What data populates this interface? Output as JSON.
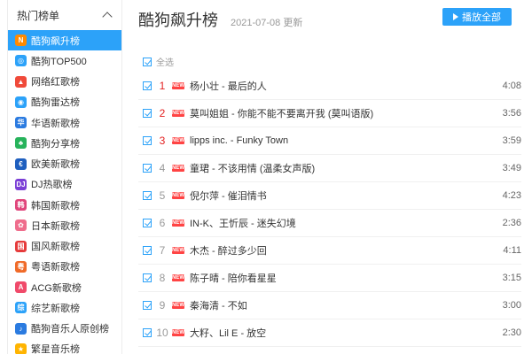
{
  "sidebar": {
    "header": "热门榜单",
    "items": [
      {
        "label": "酷狗飙升榜",
        "icon": "n-badge-icon",
        "color": "#ff8a00",
        "glyph": "N"
      },
      {
        "label": "酷狗TOP500",
        "icon": "disc-icon",
        "color": "#2ca2f9",
        "glyph": "◎"
      },
      {
        "label": "网络红歌榜",
        "icon": "flame-icon",
        "color": "#f04a3a",
        "glyph": "▲"
      },
      {
        "label": "酷狗雷达榜",
        "icon": "radar-icon",
        "color": "#2ca2f9",
        "glyph": "◉"
      },
      {
        "label": "华语新歌榜",
        "icon": "chinese-char-icon",
        "color": "#2b7be0",
        "glyph": "华"
      },
      {
        "label": "酷狗分享榜",
        "icon": "share-leaf-icon",
        "color": "#27b35b",
        "glyph": "♣"
      },
      {
        "label": "欧美新歌榜",
        "icon": "coin-e-icon",
        "color": "#1f5fbf",
        "glyph": "€"
      },
      {
        "label": "DJ热歌榜",
        "icon": "dj-icon",
        "color": "#7b3fd6",
        "glyph": "DJ"
      },
      {
        "label": "韩国新歌榜",
        "icon": "korean-girl-icon",
        "color": "#e0457b",
        "glyph": "韩"
      },
      {
        "label": "日本新歌榜",
        "icon": "sakura-icon",
        "color": "#ef6d8c",
        "glyph": "✿"
      },
      {
        "label": "国风新歌榜",
        "icon": "lantern-icon",
        "color": "#e63b3b",
        "glyph": "国"
      },
      {
        "label": "粤语新歌榜",
        "icon": "cantonese-icon",
        "color": "#f06a28",
        "glyph": "粤"
      },
      {
        "label": "ACG新歌榜",
        "icon": "acg-icon",
        "color": "#f04a6a",
        "glyph": "A"
      },
      {
        "label": "综艺新歌榜",
        "icon": "variety-icon",
        "color": "#2ca2f9",
        "glyph": "综"
      },
      {
        "label": "酷狗音乐人原创榜",
        "icon": "musician-icon",
        "color": "#2b7be0",
        "glyph": "♪"
      },
      {
        "label": "繁星音乐榜",
        "icon": "star-icon",
        "color": "#ffb400",
        "glyph": "★"
      }
    ]
  },
  "main": {
    "title": "酷狗飙升榜",
    "date": "2021-07-08 更新",
    "play_all": "播放全部",
    "select_all": "全选",
    "badge": "NEW",
    "songs": [
      {
        "rank": "1",
        "name": "杨小壮 - 最后的人",
        "duration": "4:08"
      },
      {
        "rank": "2",
        "name": "莫叫姐姐 - 你能不能不要离开我 (莫叫语版)",
        "duration": "3:56"
      },
      {
        "rank": "3",
        "name": "lipps inc. - Funky Town",
        "duration": "3:59"
      },
      {
        "rank": "4",
        "name": "童珺 - 不该用情 (温柔女声版)",
        "duration": "3:49"
      },
      {
        "rank": "5",
        "name": "倪尔萍 - 催泪情书",
        "duration": "4:23"
      },
      {
        "rank": "6",
        "name": "IN-K、王忻辰 - 迷失幻境",
        "duration": "2:36"
      },
      {
        "rank": "7",
        "name": "木杰 - 醉过多少回",
        "duration": "4:11"
      },
      {
        "rank": "8",
        "name": "陈子晴 - 陪你看星星",
        "duration": "3:15"
      },
      {
        "rank": "9",
        "name": "秦海清 - 不如",
        "duration": "3:00"
      },
      {
        "rank": "10",
        "name": "大籽、Lil E - 放空",
        "duration": "2:30"
      }
    ]
  },
  "colors": {
    "accent": "#2ca2f9",
    "top_rank": "#e31d1d",
    "badge": "#ff4444"
  }
}
